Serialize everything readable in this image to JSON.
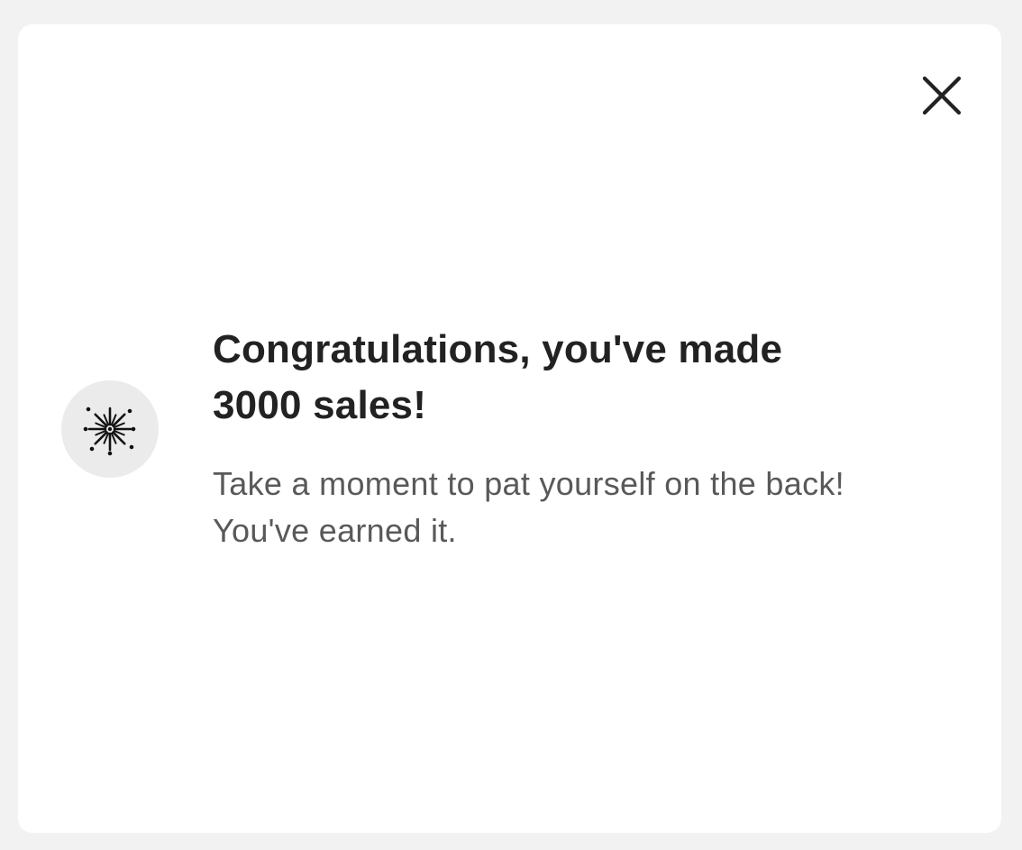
{
  "dialog": {
    "title_line1": "Congratulations, you've made",
    "title_line2": "3000 sales!",
    "message_line1": "Take a moment to pat yourself on the back!",
    "message_line2": "You've earned it.",
    "close_icon": "close-icon",
    "celebration_icon": "fireworks-icon"
  },
  "colors": {
    "background": "#f2f2f2",
    "card": "#ffffff",
    "icon_circle": "#ebebeb",
    "title_text": "#222222",
    "message_text": "#595959"
  }
}
